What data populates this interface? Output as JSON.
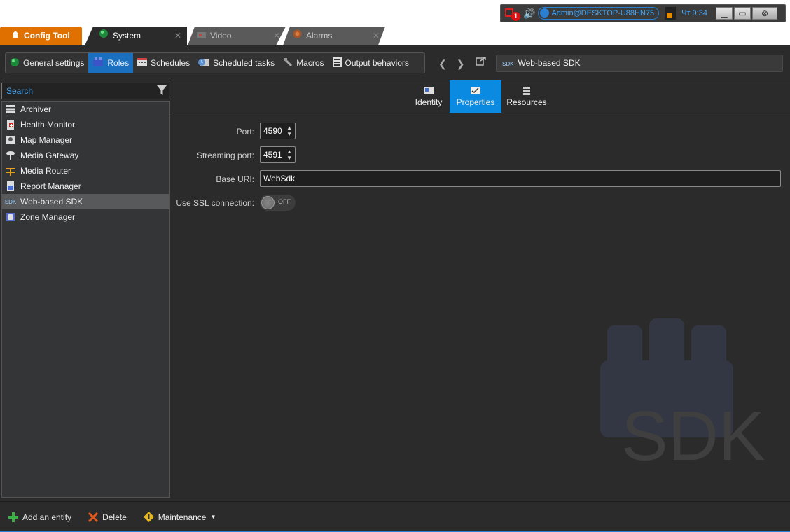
{
  "tabs": {
    "config_tool": "Config Tool",
    "system": "System",
    "video": "Video",
    "alarms": "Alarms",
    "close_glyph": "✕"
  },
  "sysbar": {
    "alarm_count": "1",
    "user": "Admin@DESKTOP-U88HN75",
    "clock": "Чт 9:34"
  },
  "toolbar": {
    "items": [
      {
        "label": "General settings",
        "icon": "globe-icon"
      },
      {
        "label": "Roles",
        "icon": "roles-icon"
      },
      {
        "label": "Schedules",
        "icon": "calendar-icon"
      },
      {
        "label": "Scheduled tasks",
        "icon": "clock-calendar-icon"
      },
      {
        "label": "Macros",
        "icon": "macro-icon"
      },
      {
        "label": "Output behaviors",
        "icon": "output-icon"
      }
    ],
    "active": "Roles",
    "breadcrumb": "Web-based SDK",
    "breadcrumb_icon_text": "SDK"
  },
  "search": {
    "placeholder": "Search"
  },
  "roles": [
    {
      "label": "Archiver",
      "icon": "archiver-icon"
    },
    {
      "label": "Health Monitor",
      "icon": "health-monitor-icon"
    },
    {
      "label": "Map Manager",
      "icon": "map-manager-icon"
    },
    {
      "label": "Media Gateway",
      "icon": "media-gateway-icon"
    },
    {
      "label": "Media Router",
      "icon": "media-router-icon"
    },
    {
      "label": "Report Manager",
      "icon": "report-manager-icon"
    },
    {
      "label": "Web-based SDK",
      "icon": "sdk-icon",
      "selected": true
    },
    {
      "label": "Zone Manager",
      "icon": "zone-manager-icon"
    }
  ],
  "subtabs": {
    "identity": "Identity",
    "properties": "Properties",
    "resources": "Resources",
    "active": "Properties"
  },
  "properties": {
    "port_label": "Port:",
    "port_value": "4590",
    "streaming_port_label": "Streaming port:",
    "streaming_port_value": "4591",
    "base_uri_label": "Base URI:",
    "base_uri_value": "WebSdk",
    "ssl_label": "Use SSL connection:",
    "ssl_state": "OFF"
  },
  "watermark_text": "SDK",
  "bottom": {
    "add": "Add an entity",
    "delete": "Delete",
    "maintenance": "Maintenance"
  },
  "colors": {
    "accent": "#0a8ae0",
    "config_tab": "#e07000",
    "background": "#2b2b2b"
  }
}
